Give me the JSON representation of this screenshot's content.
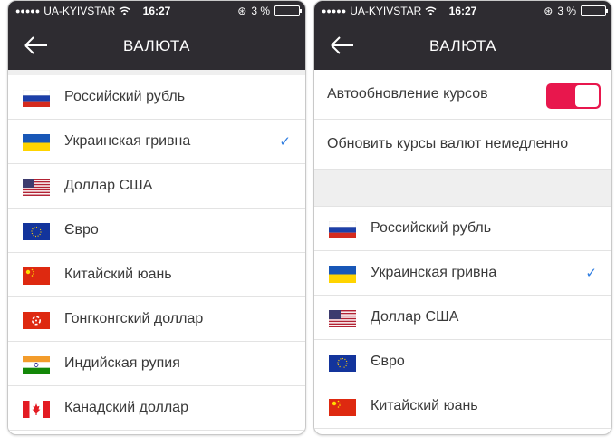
{
  "status_bar": {
    "carrier": "UA-KYIVSTAR",
    "time": "16:27",
    "battery_percent": "3 %"
  },
  "left_screen": {
    "title": "ВАЛЮТА",
    "currencies": [
      {
        "label": "Российский рубль",
        "flag": "russia-flag-icon",
        "selected": false
      },
      {
        "label": "Украинская гривна",
        "flag": "ukraine-flag-icon",
        "selected": true
      },
      {
        "label": "Доллар США",
        "flag": "usa-flag-icon",
        "selected": false
      },
      {
        "label": "Євро",
        "flag": "eu-flag-icon",
        "selected": false
      },
      {
        "label": "Китайский юань",
        "flag": "china-flag-icon",
        "selected": false
      },
      {
        "label": "Гонгконгский доллар",
        "flag": "hong-kong-flag-icon",
        "selected": false
      },
      {
        "label": "Индийская рупия",
        "flag": "india-flag-icon",
        "selected": false
      },
      {
        "label": "Канадский доллар",
        "flag": "canada-flag-icon",
        "selected": false
      }
    ]
  },
  "right_screen": {
    "title": "ВАЛЮТА",
    "auto_update_label": "Автообновление курсов",
    "auto_update_on": true,
    "update_now_label": "Обновить курсы валют немедленно",
    "currencies": [
      {
        "label": "Российский рубль",
        "flag": "russia-flag-icon",
        "selected": false
      },
      {
        "label": "Украинская гривна",
        "flag": "ukraine-flag-icon",
        "selected": true
      },
      {
        "label": "Доллар США",
        "flag": "usa-flag-icon",
        "selected": false
      },
      {
        "label": "Євро",
        "flag": "eu-flag-icon",
        "selected": false
      },
      {
        "label": "Китайский юань",
        "flag": "china-flag-icon",
        "selected": false
      }
    ]
  },
  "colors": {
    "bar_background": "#2e2c31",
    "toggle_on": "#e8174d",
    "checkmark": "#2f7de1",
    "separator": "#efefef"
  }
}
